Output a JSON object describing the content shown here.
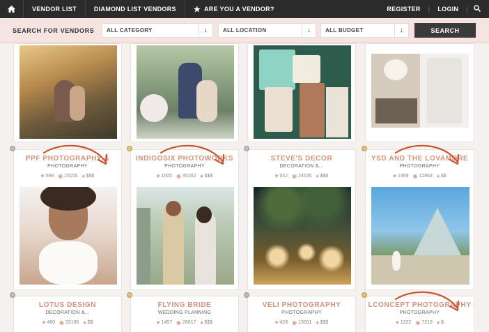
{
  "nav": {
    "items": [
      "VENDOR LIST",
      "DIAMOND LIST VENDORS",
      "ARE YOU A VENDOR?"
    ],
    "register": "REGISTER",
    "login": "LOGIN",
    "sep": "|"
  },
  "search": {
    "label": "SEARCH FOR VENDORS",
    "category": "ALL CATEGORY",
    "location": "ALL LOCATION",
    "budget": "ALL BUDGET",
    "button": "SEARCH",
    "arrow": "↓"
  },
  "vendors": [
    {
      "name": "PPF PHOTOGRAPHY &",
      "category": "PHOTOGRAPHY",
      "likes": "598",
      "views": "23155",
      "price": "$$$"
    },
    {
      "name": "INDIGOSIX PHOTOWORKS",
      "category": "PHOTOGRAPHY",
      "likes": "1505",
      "views": "45352",
      "price": "$$$"
    },
    {
      "name": "STEVE'S DECOR",
      "category": "DECORATION &...",
      "likes": "542",
      "views": "24535",
      "price": "$$$"
    },
    {
      "name": "YSD AND THE LOVAMORE",
      "category": "PHOTOGRAPHY",
      "likes": "1489",
      "views": "12863",
      "price": "$$"
    },
    {
      "name": "LOTUS DESIGN",
      "category": "DECORATION &...",
      "likes": "460",
      "views": "32185",
      "price": "$$"
    },
    {
      "name": "FLYING BRIDE",
      "category": "WEDDING PLANNING",
      "likes": "1457",
      "views": "28817",
      "price": "$$$"
    },
    {
      "name": "VELI PHOTOGRAPHY",
      "category": "PHOTOGRAPHY",
      "likes": "428",
      "views": "13001",
      "price": "$$$"
    },
    {
      "name": "LCONCEPT PHOTOGRAPHY",
      "category": "PHOTOGRAPHY",
      "likes": "1222",
      "views": "7216",
      "price": "$"
    }
  ],
  "icons": {
    "home": "home-icon",
    "star": "star-icon",
    "search": "search-icon",
    "heart": "heart-icon",
    "eye": "eye-icon",
    "bag": "money-bag-icon"
  },
  "colors": {
    "accent": "#d9907a",
    "arrow": "#c9552f",
    "nav": "#2b2b2b",
    "searchbar": "#f6e4e1"
  }
}
